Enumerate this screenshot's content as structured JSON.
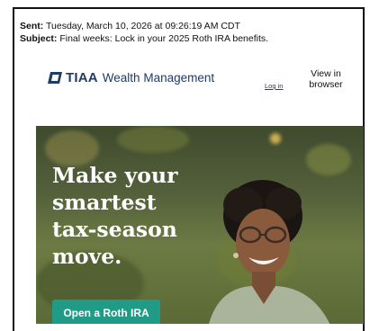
{
  "email": {
    "sent_label": "Sent:",
    "sent_value": "Tuesday, March 10, 2026 at 09:26:19 AM CDT",
    "subject_label": "Subject:",
    "subject_value": "Final weeks: Lock in your 2025 Roth IRA benefits."
  },
  "header": {
    "logo_brand": "TIAA",
    "logo_tagline": "Wealth Management",
    "login_link": "Log in",
    "view_line1": "View in",
    "view_line2": "browser"
  },
  "hero": {
    "headline": [
      "Make your",
      "smartest",
      "tax-season",
      "move."
    ],
    "cta_label": "Open a Roth IRA"
  },
  "colors": {
    "brand_navy": "#1f3c64",
    "cta_teal": "#1f9b87"
  }
}
